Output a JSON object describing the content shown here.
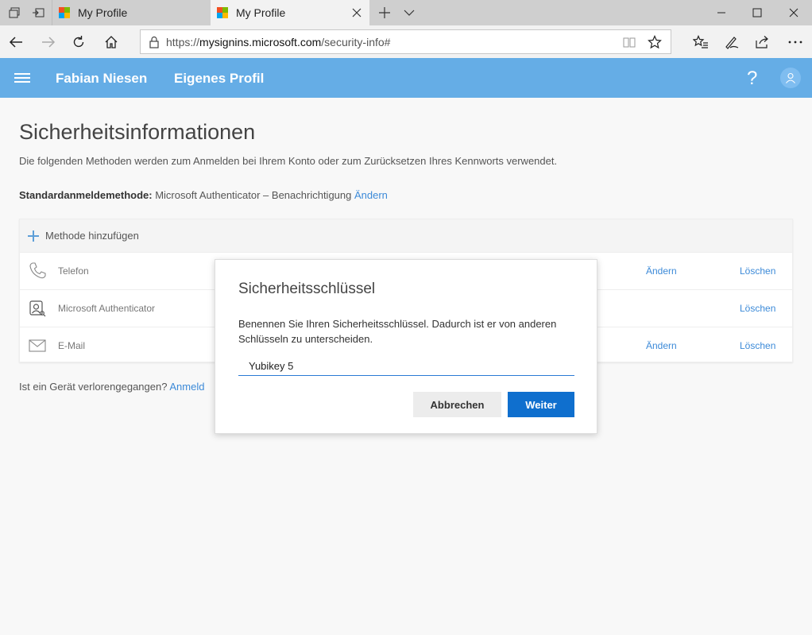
{
  "browser": {
    "tabs": [
      {
        "title": "My Profile"
      },
      {
        "title": "My Profile"
      }
    ],
    "url_prefix": "https://",
    "url_domain": "mysignins.microsoft.com",
    "url_path": "/security-info#"
  },
  "header": {
    "user_name": "Fabian Niesen",
    "profile_link": "Eigenes Profil",
    "help_glyph": "?"
  },
  "page": {
    "title": "Sicherheitsinformationen",
    "description": "Die folgenden Methoden werden zum Anmelden bei Ihrem Konto oder zum Zurücksetzen Ihres Kennworts verwendet.",
    "default_method_label": "Standardanmeldemethode:",
    "default_method_value": "Microsoft Authenticator – Benachrichtigung",
    "default_method_change": "Ändern",
    "add_method": "Methode hinzufügen",
    "methods": [
      {
        "name": "Telefon",
        "change": "Ändern",
        "delete": "Löschen",
        "icon": "phone-icon"
      },
      {
        "name": "Microsoft Authenticator",
        "change": "",
        "delete": "Löschen",
        "icon": "authenticator-icon"
      },
      {
        "name": "E-Mail",
        "change": "Ändern",
        "delete": "Löschen",
        "icon": "mail-icon"
      }
    ],
    "lost_device_text": "Ist ein Gerät verlorengegangen?",
    "lost_device_link": "Anmeld"
  },
  "dialog": {
    "title": "Sicherheitsschlüssel",
    "text": "Benennen Sie Ihren Sicherheitsschlüssel. Dadurch ist er von anderen Schlüsseln zu unterscheiden.",
    "input_value": "Yubikey 5",
    "cancel": "Abbrechen",
    "next": "Weiter"
  },
  "colors": {
    "header": "#65ade6",
    "link": "#3c8ad8",
    "primary_button": "#0f6fce"
  }
}
